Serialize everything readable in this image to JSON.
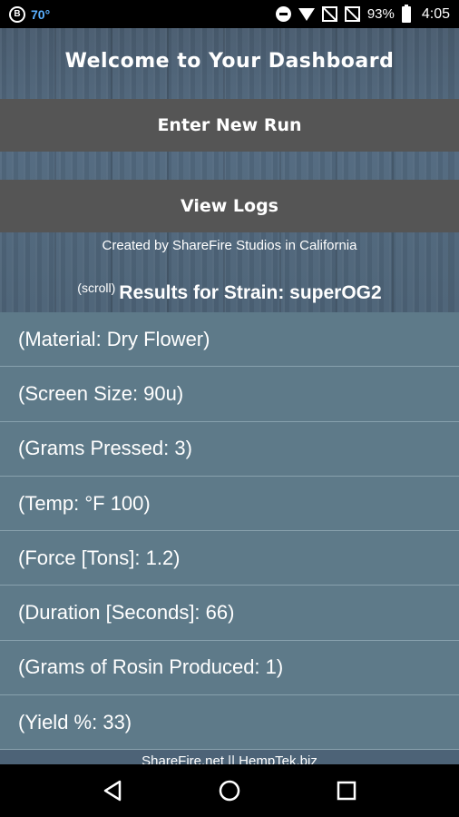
{
  "status_bar": {
    "badge": "B",
    "temperature": "70°",
    "battery_percent": "93%",
    "time": "4:05"
  },
  "header": {
    "title": "Welcome to Your Dashboard",
    "enter_run_label": "Enter New Run",
    "view_logs_label": "View Logs",
    "credit": "Created by ShareFire Studios in California",
    "scroll_hint": "(scroll)",
    "results_heading": "Results for Strain:  superOG2"
  },
  "results": [
    "(Material:  Dry Flower)",
    "(Screen Size:  90u)",
    "(Grams Pressed: 3)",
    "(Temp: °F 100)",
    "(Force [Tons]:  1.2)",
    "(Duration [Seconds]:  66)",
    "(Grams of Rosin Produced:  1)",
    "(Yield %: 33)"
  ],
  "footer": {
    "text": "ShareFire.net || HempTek.biz"
  },
  "colors": {
    "list_bg": "#5e7a89",
    "button_bg": "#555555",
    "temp_accent": "#5ab0ff"
  }
}
